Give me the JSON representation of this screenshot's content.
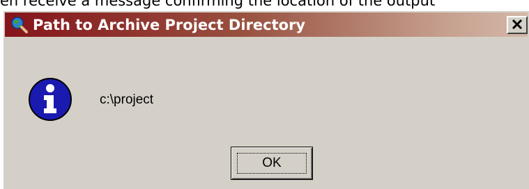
{
  "background_caption": "en receive a message confirming the location of the output",
  "dialog": {
    "title": "Path to Archive Project Directory",
    "app_icon": "globe-magnifier-icon",
    "close_glyph": "✕",
    "message_icon": "info-icon",
    "message": "c:\\project",
    "ok_label": "OK"
  },
  "colors": {
    "face": "#d4d0c8",
    "title_start": "#85141b",
    "title_end": "#d3b8a8",
    "info_blue": "#1a1ab0"
  }
}
